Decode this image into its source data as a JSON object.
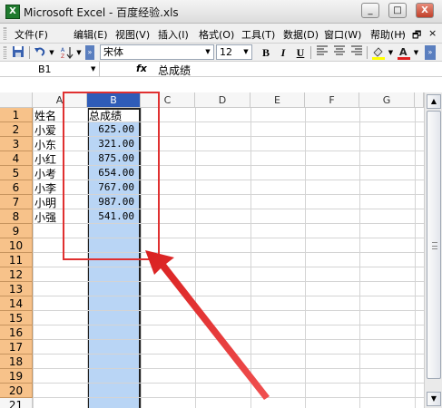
{
  "window": {
    "title": "Microsoft Excel - 百度经验.xls",
    "min_label": "_",
    "max_label": "□",
    "close_label": "X"
  },
  "menu": {
    "items": [
      "文件(F)",
      "编辑(E)",
      "视图(V)",
      "插入(I)",
      "格式(O)",
      "工具(T)",
      "数据(D)",
      "窗口(W)",
      "帮助(H)"
    ],
    "doc_controls": [
      "–",
      "🗗",
      "×"
    ]
  },
  "toolbar": {
    "font_name": "宋体",
    "font_size": "12",
    "bold": "B",
    "italic": "I",
    "underline": "U",
    "font_color_label": "A"
  },
  "formula_bar": {
    "name_box": "B1",
    "fx_label": "fx",
    "content": "总成绩"
  },
  "grid": {
    "columns": [
      "A",
      "B",
      "C",
      "D",
      "E",
      "F",
      "G"
    ],
    "selected_column": "B",
    "rows": [
      "1",
      "2",
      "3",
      "4",
      "5",
      "6",
      "7",
      "8",
      "9",
      "10",
      "11",
      "12",
      "13",
      "14",
      "15",
      "16",
      "17",
      "18",
      "19",
      "20",
      "21"
    ],
    "cells": [
      {
        "a": "姓名",
        "b": "总成绩"
      },
      {
        "a": "小爱",
        "b": "625.00"
      },
      {
        "a": "小东",
        "b": "321.00"
      },
      {
        "a": "小红",
        "b": "875.00"
      },
      {
        "a": "小考",
        "b": "654.00"
      },
      {
        "a": "小李",
        "b": "767.00"
      },
      {
        "a": "小明",
        "b": "987.00"
      },
      {
        "a": "小强",
        "b": "541.00"
      }
    ]
  },
  "colors": {
    "selected_column_fill": "#b9d5f5",
    "row_header": "#f7c28a",
    "annotation": "#e03030"
  }
}
